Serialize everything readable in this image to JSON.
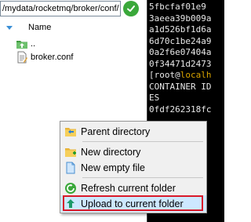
{
  "path_bar": {
    "value": "/mydata/rocketmq/broker/conf/",
    "go_button_icon": "check-icon"
  },
  "file_list": {
    "column_header": "Name",
    "items": [
      {
        "label": "..",
        "icon": "parent-folder-icon"
      },
      {
        "label": "broker.conf",
        "icon": "text-file-icon"
      }
    ]
  },
  "terminal": {
    "lines": [
      "5fbcfaf01e9",
      "3aeea39b009a",
      "a1d526bf1d6a",
      "6d70c1be24a9",
      "0a2f6e07404a",
      "0f34471d2473"
    ],
    "prompt_open": "[root@",
    "prompt_host": "localh",
    "lines_after": [
      "CONTAINER ID",
      "ES",
      "0fdf262318fc"
    ]
  },
  "context_menu": {
    "items": [
      {
        "label": "Parent directory",
        "icon": "parent-directory-icon"
      },
      {
        "label": "New directory",
        "icon": "new-folder-icon"
      },
      {
        "label": "New empty file",
        "icon": "new-file-icon"
      },
      {
        "label": "Refresh current folder",
        "icon": "refresh-icon"
      },
      {
        "label": "Upload to current folder",
        "icon": "upload-icon"
      }
    ],
    "highlight_color": "#d9192a"
  }
}
